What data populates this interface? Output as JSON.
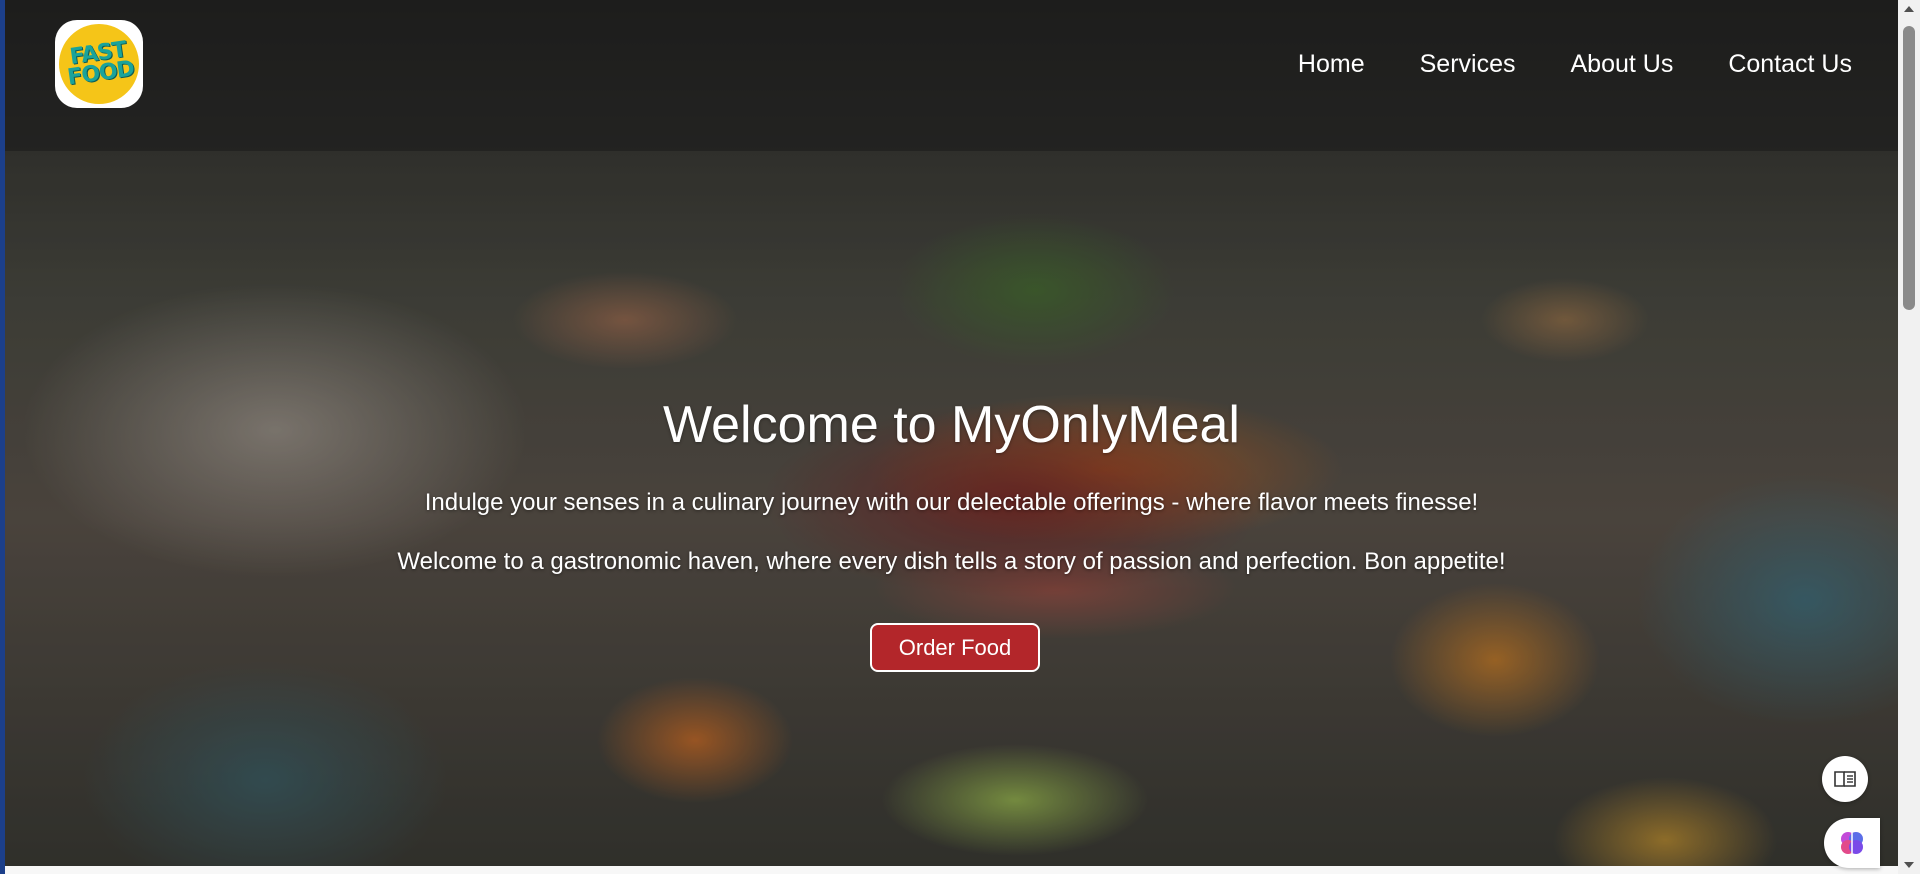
{
  "logo": {
    "text_line1": "FAST",
    "text_line2": "FOOD"
  },
  "nav": {
    "items": [
      {
        "label": "Home"
      },
      {
        "label": "Services"
      },
      {
        "label": "About Us"
      },
      {
        "label": "Contact Us"
      }
    ]
  },
  "hero": {
    "title": "Welcome to MyOnlyMeal",
    "line1": "Indulge your senses in a culinary journey with our delectable offerings - where flavor meets finesse!",
    "line2": "Welcome to a gastronomic haven, where every dish tells a story of passion and perfection. Bon appetite!",
    "order_button": "Order Food"
  },
  "colors": {
    "button": "#b3262a",
    "logo_bg": "#f5c518",
    "logo_text": "#1aa39a"
  },
  "floating": {
    "reader_icon": "immersive-reader-icon",
    "assistant_icon": "brain-assistant-icon"
  }
}
